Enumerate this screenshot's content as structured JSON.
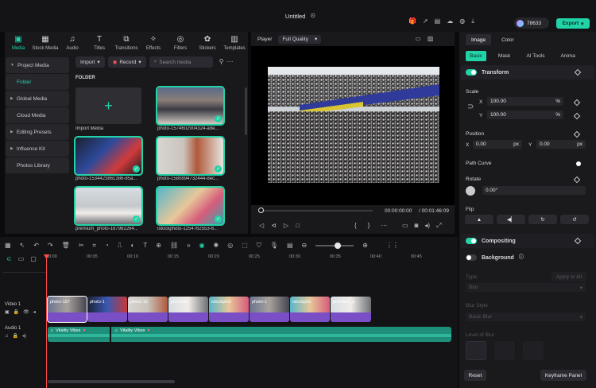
{
  "window": {
    "title": "Untitled"
  },
  "topbar": {
    "credits": "78633",
    "export_label": "Export"
  },
  "media_tabs": [
    {
      "label": "Media",
      "icon": "media-icon"
    },
    {
      "label": "Stock Media",
      "icon": "stock-media-icon"
    },
    {
      "label": "Audio",
      "icon": "audio-icon"
    },
    {
      "label": "Titles",
      "icon": "titles-icon"
    },
    {
      "label": "Transitions",
      "icon": "transitions-icon"
    },
    {
      "label": "Effects",
      "icon": "effects-icon"
    },
    {
      "label": "Filters",
      "icon": "filters-icon"
    },
    {
      "label": "Stickers",
      "icon": "stickers-icon"
    },
    {
      "label": "Templates",
      "icon": "templates-icon"
    }
  ],
  "sidebar": {
    "items": [
      {
        "label": "Project Media"
      },
      {
        "label": "Folder"
      },
      {
        "label": "Global Media"
      },
      {
        "label": "Cloud Media"
      },
      {
        "label": "Editing Presets"
      },
      {
        "label": "Influence Kit"
      },
      {
        "label": "Photos Library"
      }
    ]
  },
  "media_toolbar": {
    "import_label": "Import",
    "record_label": "Record",
    "search_placeholder": "Search media"
  },
  "media_area": {
    "folder_label": "FOLDER",
    "import_caption": "Import Media",
    "items": [
      {
        "caption": "photo-1574602904324-a9e..."
      },
      {
        "caption": "photo-1534423861386-85a..."
      },
      {
        "caption": "photo-1580894732444-8ec..."
      },
      {
        "caption": "premium_photo-167982264..."
      },
      {
        "caption": "istockphoto-1254762553-6..."
      }
    ]
  },
  "player": {
    "label": "Player",
    "quality": "Full Quality",
    "current_time": "00:00:00:00",
    "total_time": "/ 00:01:46:09"
  },
  "properties": {
    "tabs": [
      "Image",
      "Color"
    ],
    "subtabs": [
      "Basic",
      "Mask",
      "AI Tools",
      "Anima"
    ],
    "transform": {
      "title": "Transform",
      "scale_label": "Scale",
      "x_label": "X",
      "y_label": "Y",
      "scale_x": "100.00",
      "scale_y": "100.00",
      "unit_pct": "%",
      "position_label": "Position",
      "pos_x": "0.00",
      "pos_y": "0.00",
      "unit_px": "px",
      "path_curve_label": "Path Curve",
      "rotate_label": "Rotate",
      "rotate_value": "0.00°",
      "flip_label": "Flip"
    },
    "compositing": {
      "title": "Compositing"
    },
    "background": {
      "title": "Background",
      "type_label": "Type",
      "apply_all": "Apply to All",
      "type_value": "Blur",
      "blur_style_label": "Blur Style",
      "blur_style_value": "Basic Blur",
      "level_label": "Level of Blur"
    },
    "reset_label": "Reset",
    "keyframe_label": "Keyframe Panel"
  },
  "timeline": {
    "ruler": [
      "00:00",
      "00:05",
      "00:10",
      "00:15",
      "00:20",
      "00:25",
      "00:30",
      "00:35",
      "00:40",
      "00:45"
    ],
    "video_track_label": "Video 1",
    "audio_track_label": "Audio 1",
    "clips": [
      {
        "name": "photo-157"
      },
      {
        "name": "photo-1"
      },
      {
        "name": "photo-15"
      },
      {
        "name": "premium"
      },
      {
        "name": "istockphot"
      },
      {
        "name": "photo-1"
      },
      {
        "name": "istockpho"
      },
      {
        "name": "premium_p"
      }
    ],
    "audio_clips": [
      {
        "name": "Vitality Vibes"
      },
      {
        "name": "Vitality Vibes"
      }
    ]
  },
  "colors": {
    "accent": "#22d3a8",
    "clip": "#7a4fc6",
    "audio": "#1d8f7a",
    "playhead": "#ff4b4b"
  }
}
